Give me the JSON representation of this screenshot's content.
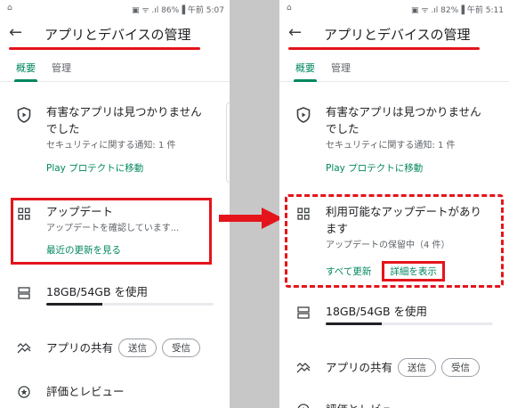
{
  "left": {
    "status": {
      "left_icon": "⌂",
      "right_text": "▣ ᯤ .ıl 86%▐ 午前 5:07"
    },
    "appbar": {
      "back_glyph": "←",
      "title": "アプリとデバイスの管理"
    },
    "tabs": [
      {
        "label": "概要"
      },
      {
        "label": "管理"
      }
    ],
    "protect": {
      "title_line1": "有害なアプリは見つかりません",
      "title_line2": "でした",
      "sub": "セキュリティに関する通知: 1 件",
      "link": "Play プロテクトに移動"
    },
    "updates": {
      "title": "アップデート",
      "sub": "アップデートを確認しています...",
      "link": "最近の更新を見る"
    },
    "storage": {
      "label": "18GB/54GB を使用",
      "fraction": 0.333
    },
    "share": {
      "label": "アプリの共有",
      "send": "送信",
      "receive": "受信"
    },
    "reviews": {
      "label": "評価とレビュー"
    }
  },
  "right": {
    "status": {
      "left_icon": "⌂",
      "right_text": "▣ ᯤ .ıl 82%▐ 午前 5:11"
    },
    "appbar": {
      "back_glyph": "←",
      "title": "アプリとデバイスの管理"
    },
    "tabs": [
      {
        "label": "概要"
      },
      {
        "label": "管理"
      }
    ],
    "protect": {
      "title_line1": "有害なアプリは見つかりません",
      "title_line2": "でした",
      "sub": "セキュリティに関する通知: 1 件",
      "link": "Play プロテクトに移動"
    },
    "updates": {
      "title_line1": "利用可能なアップデートがあり",
      "title_line2": "ます",
      "sub": "アップデートの保留中（4 件）",
      "update_all": "すべて更新",
      "details": "詳細を表示"
    },
    "storage": {
      "label": "18GB/54GB を使用",
      "fraction": 0.333
    },
    "share": {
      "label": "アプリの共有",
      "send": "送信",
      "receive": "受信"
    },
    "reviews": {
      "label": "評価とレビュー"
    }
  },
  "colors": {
    "accent": "#01875f",
    "highlight": "#e5141b",
    "divider": "#c7c7c7"
  },
  "icons": {
    "back": "arrow-back-icon",
    "protect": "play-protect-shield-icon",
    "updates": "apps-grid-icon",
    "storage": "storage-icon",
    "share": "share-apps-icon",
    "reviews": "star-circle-icon",
    "arrow": "red-arrow-icon"
  }
}
